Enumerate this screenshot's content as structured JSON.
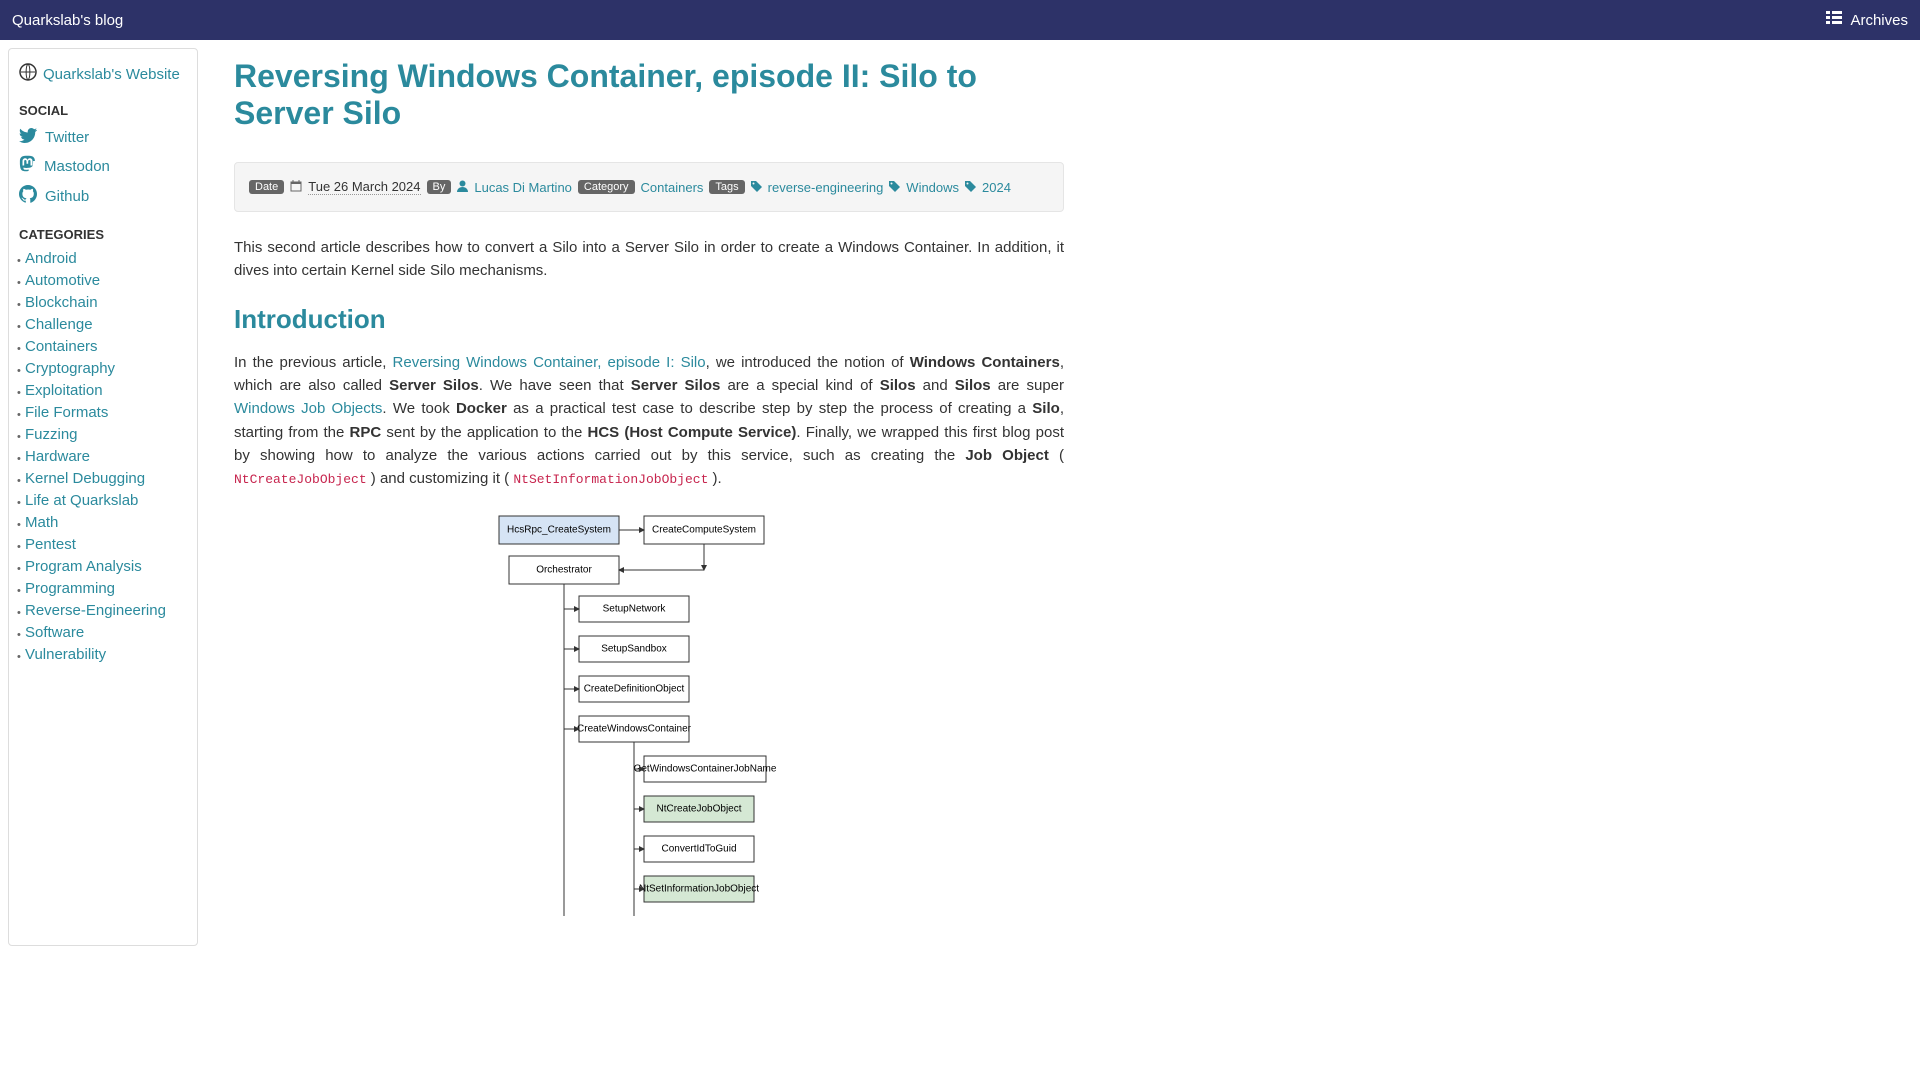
{
  "nav": {
    "brand": "Quarkslab's blog",
    "archives": "Archives"
  },
  "sidebar": {
    "website_label": "Quarkslab's Website",
    "social_heading": "SOCIAL",
    "social": [
      {
        "label": "Twitter",
        "icon": "twitter"
      },
      {
        "label": "Mastodon",
        "icon": "mastodon"
      },
      {
        "label": "Github",
        "icon": "github"
      }
    ],
    "categories_heading": "CATEGORIES",
    "categories": [
      "Android",
      "Automotive",
      "Blockchain",
      "Challenge",
      "Containers",
      "Cryptography",
      "Exploitation",
      "File Formats",
      "Fuzzing",
      "Hardware",
      "Kernel Debugging",
      "Life at Quarkslab",
      "Math",
      "Pentest",
      "Program Analysis",
      "Programming",
      "Reverse-Engineering",
      "Software",
      "Vulnerability"
    ]
  },
  "article": {
    "title": "Reversing Windows Container, episode II: Silo to Server Silo",
    "meta": {
      "date_badge": "Date",
      "date": "Tue 26 March 2024",
      "by_badge": "By",
      "author": "Lucas Di Martino",
      "category_badge": "Category",
      "category": "Containers",
      "tags_badge": "Tags",
      "tags": [
        "reverse-engineering",
        "Windows",
        "2024"
      ]
    },
    "lead": "This second article describes how to convert a Silo into a Server Silo in order to create a Windows Container. In addition, it dives into certain Kernel side Silo mechanisms.",
    "intro_heading": "Introduction",
    "intro_p1_a": "In the previous article, ",
    "intro_p1_link1": "Reversing Windows Container, episode I: Silo",
    "intro_p1_b": ", we introduced the notion of ",
    "intro_p1_bold1": "Windows Containers",
    "intro_p1_c": ", which are also called ",
    "intro_p1_bold2": "Server Silos",
    "intro_p1_d": ". We have seen that ",
    "intro_p1_bold3": "Server Silos",
    "intro_p1_e": " are a special kind of ",
    "intro_p1_bold4": "Silos",
    "intro_p1_f": " and ",
    "intro_p1_bold5": "Silos",
    "intro_p1_g": " are super ",
    "intro_p1_link2": "Windows Job Objects",
    "intro_p1_h": ". We took ",
    "intro_p1_bold6": "Docker",
    "intro_p1_i": " as a practical test case to describe step by step the process of creating a ",
    "intro_p1_bold7": "Silo",
    "intro_p1_j": ", starting from the ",
    "intro_p1_bold8": "RPC",
    "intro_p1_k": " sent by the application to the ",
    "intro_p1_bold9": "HCS (Host Compute Service)",
    "intro_p1_l": ". Finally, we wrapped this first blog post by showing how to analyze the various actions carried out by this service, such as creating the ",
    "intro_p1_bold10": "Job Object",
    "intro_p1_m": " ( ",
    "intro_p1_code1": "NtCreateJobObject",
    "intro_p1_n": " ) and customizing it ( ",
    "intro_p1_code2": "NtSetInformationJobObject",
    "intro_p1_o": " ).",
    "diagram": {
      "nodes": [
        "HcsRpc_CreateSystem",
        "CreateComputeSystem",
        "Orchestrator",
        "SetupNetwork",
        "SetupSandbox",
        "CreateDefinitionObject",
        "CreateWindowsContainer",
        "GetWindowsContainerJobName",
        "NtCreateJobObject",
        "ConvertIdToGuid",
        "NtSetInformationJobObject"
      ]
    }
  }
}
